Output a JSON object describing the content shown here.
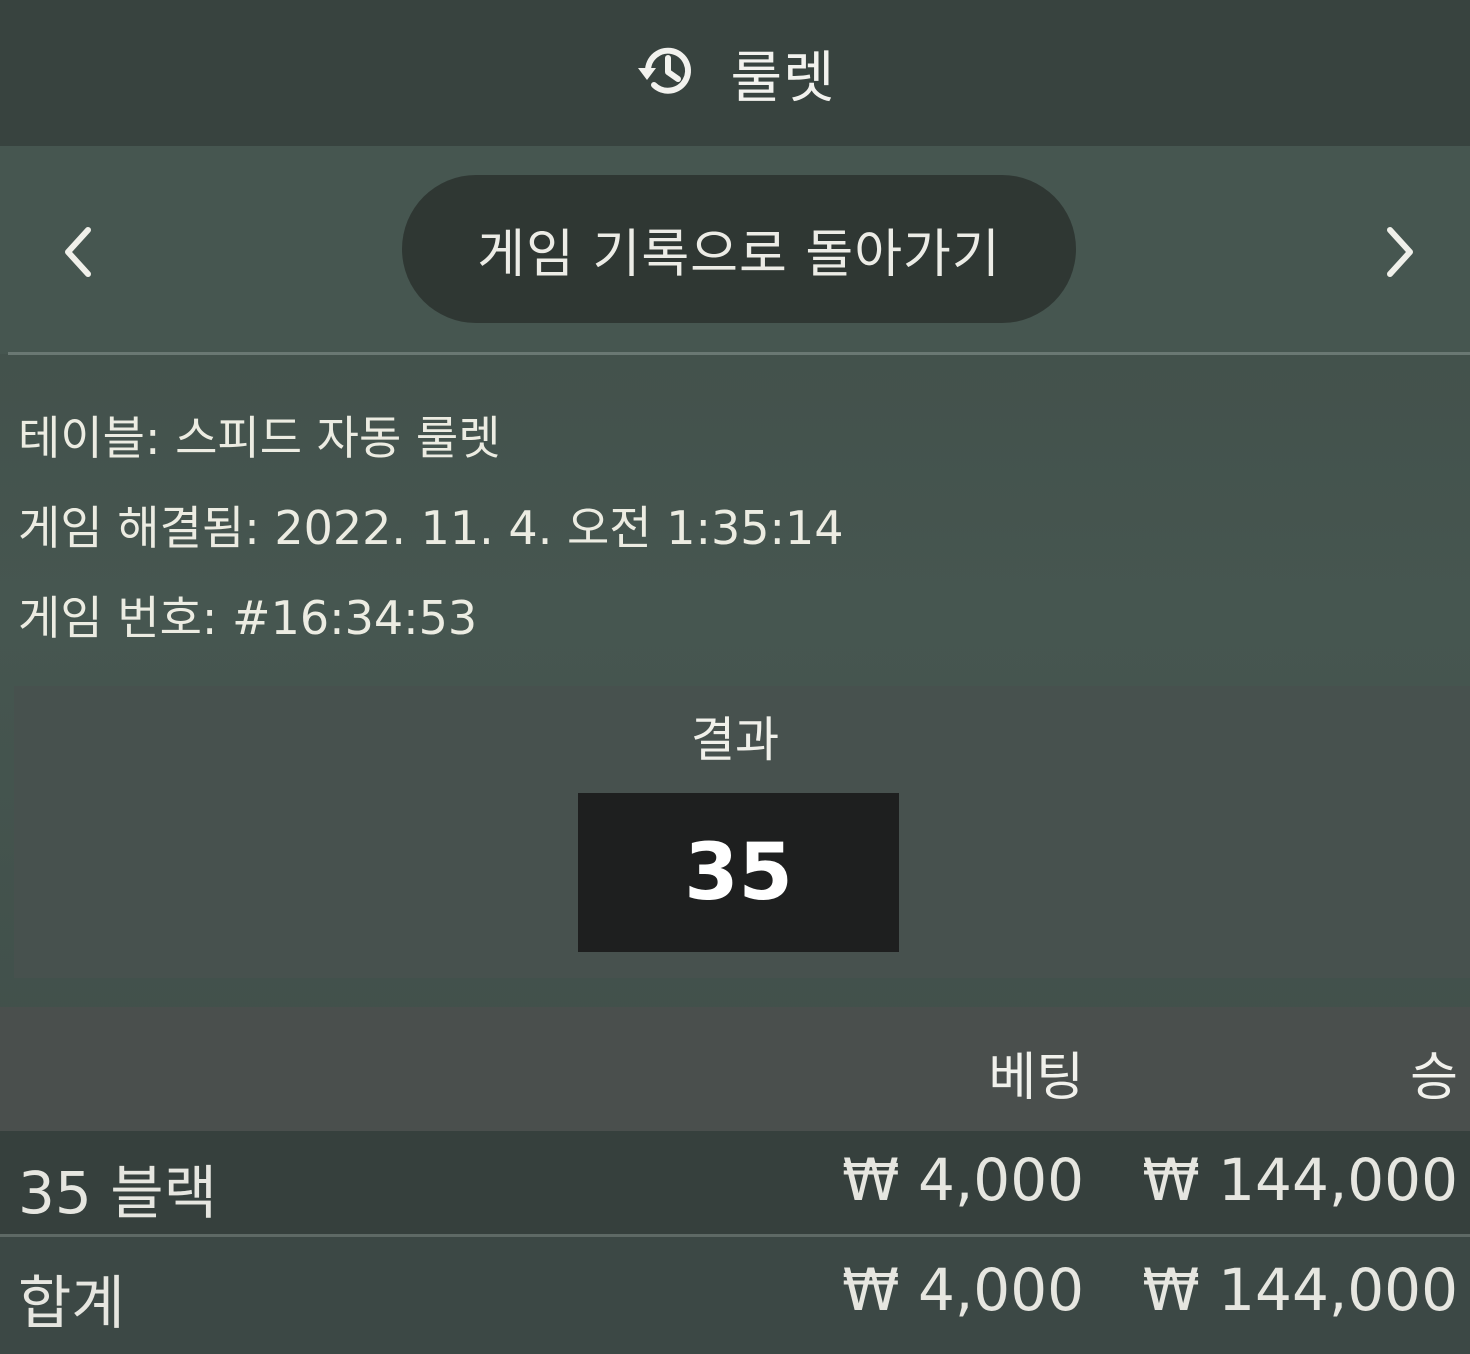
{
  "header": {
    "title": "룰렛",
    "icon": "history-icon"
  },
  "nav": {
    "prev_icon": "chevron-left-icon",
    "next_icon": "chevron-right-icon",
    "back_label": "게임 기록으로 돌아가기"
  },
  "info": {
    "table": "테이블: 스피드 자동 룰렛",
    "resolved": "게임 해결됨: 2022. 11. 4. 오전 1:35:14",
    "game_number": "게임 번호: #16:34:53"
  },
  "result": {
    "label": "결과",
    "number": "35"
  },
  "bets_table": {
    "headers": {
      "bet": "베팅",
      "win": "승"
    },
    "rows": [
      {
        "name": "35 블랙",
        "bet": "₩ 4,000",
        "win": "₩ 144,000"
      }
    ],
    "total": {
      "name": "합계",
      "bet": "₩ 4,000",
      "win": "₩ 144,000"
    }
  }
}
